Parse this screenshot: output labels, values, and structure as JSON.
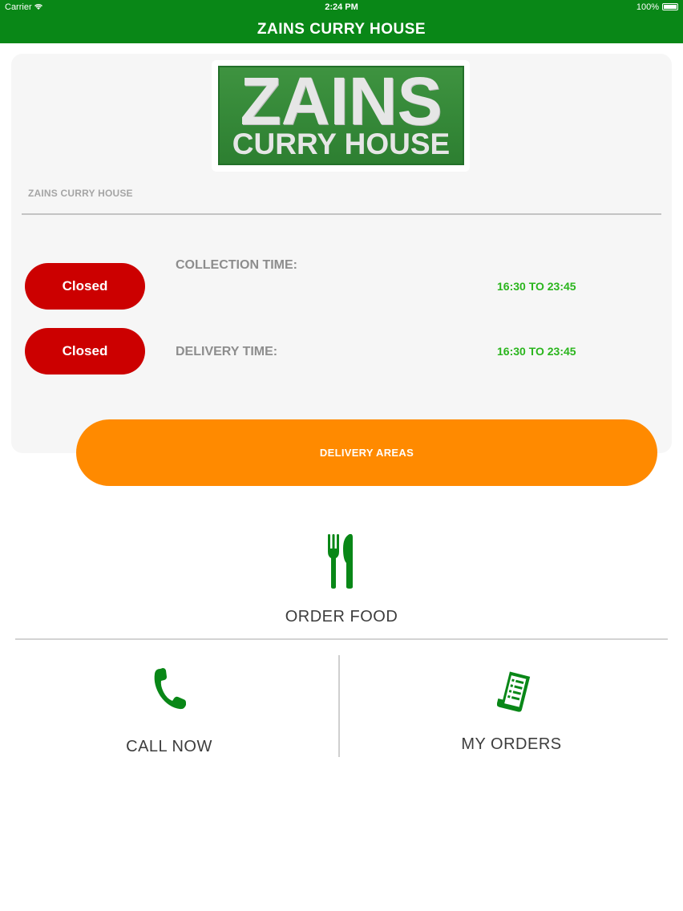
{
  "status_bar": {
    "carrier": "Carrier",
    "time": "2:24 PM",
    "battery": "100%"
  },
  "header": {
    "title": "ZAINS CURRY HOUSE"
  },
  "logo": {
    "line1": "ZAINS",
    "line2": "CURRY HOUSE"
  },
  "restaurant": {
    "name": "ZAINS CURRY HOUSE"
  },
  "hours": {
    "collection": {
      "status": "Closed",
      "label": "COLLECTION TIME:",
      "time": "16:30 TO 23:45"
    },
    "delivery": {
      "status": "Closed",
      "label": "DELIVERY TIME:",
      "time": "16:30 TO 23:45"
    }
  },
  "actions": {
    "delivery_areas": "DELIVERY AREAS",
    "order_food": "ORDER FOOD",
    "call_now": "CALL NOW",
    "my_orders": "MY ORDERS"
  },
  "icons": {
    "order_food": "fork-knife-icon",
    "call_now": "phone-icon",
    "my_orders": "receipt-icon"
  },
  "colors": {
    "brand_green": "#098717",
    "closed_red": "#cc0000",
    "time_green": "#2ab51d",
    "accent_orange": "#ff8a00"
  }
}
